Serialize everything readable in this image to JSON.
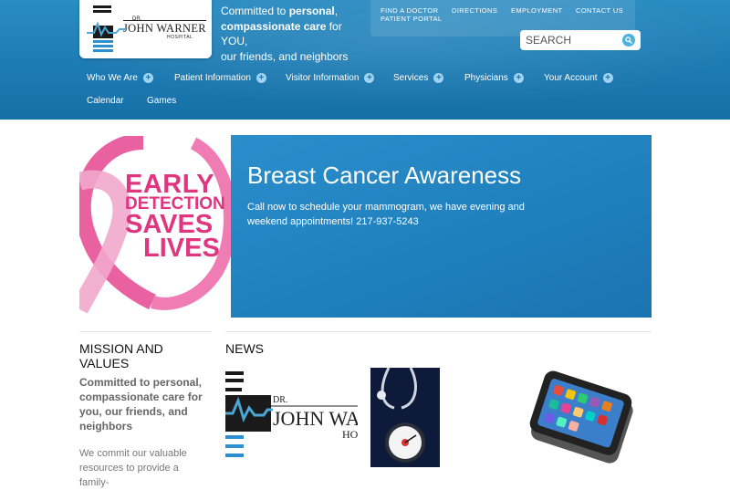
{
  "logo": {
    "dr": "DR.",
    "name": "JOHN WARNER",
    "hospital": "HOSPITAL"
  },
  "tagline": {
    "p1": "Committed to ",
    "b1": "personal",
    "p2": ",",
    "b2": "compassionate care",
    "p3": " for YOU,",
    "p4": "our friends, and neighbors"
  },
  "utility": {
    "find_doctor": "FIND A DOCTOR",
    "directions": "DIRECTIONS",
    "employment": "EMPLOYMENT",
    "contact": "CONTACT US",
    "portal": "PATIENT PORTAL"
  },
  "search": {
    "placeholder": "SEARCH",
    "icon": "search-icon"
  },
  "nav": {
    "who": "Who We Are",
    "patient": "Patient Information",
    "visitor": "Visitor Information",
    "services": "Services",
    "physicians": "Physicians",
    "account": "Your Account",
    "calendar": "Calendar",
    "games": "Games",
    "plus_symbol": "+"
  },
  "hero": {
    "image_text": {
      "l1": "EARLY",
      "l2": "DETECTION",
      "l3": "SAVES",
      "l4": "LIVES"
    },
    "title": "Breast Cancer Awareness",
    "subtitle": "Call now to schedule your mammogram, we have evening and weekend appointments! 217-937-5243"
  },
  "mission": {
    "title": "MISSION AND VALUES",
    "subtitle": "Committed to personal, compassionate care for you, our friends, and neighbors",
    "body": "We commit our valuable resources to provide a family-"
  },
  "news": {
    "title": "NEWS",
    "thumb1_logo": {
      "dr": "DR.",
      "name": "JOHN WAI",
      "hospital": "HO"
    }
  },
  "colors": {
    "header": "#1d7bb3",
    "accent": "#e0357f",
    "panel": "#2287c4"
  }
}
